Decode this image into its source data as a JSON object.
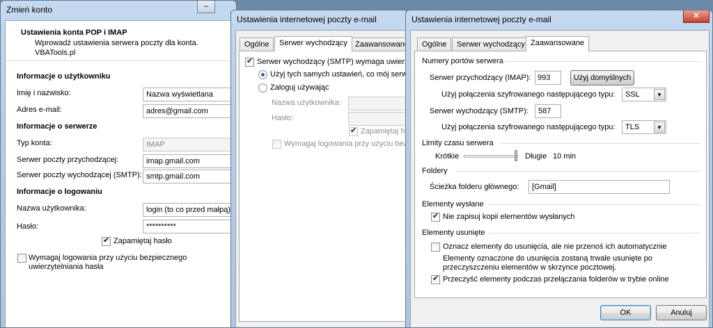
{
  "win1": {
    "title": "Zmień konto",
    "header_title": "Ustawienia konta POP i IMAP",
    "header_sub": "Wprowadź ustawienia serwera poczty dla konta.",
    "header_sub2": "VBATools.pl",
    "user_section": "Informacje o użytkowniku",
    "name_label": "Imię i nazwisko:",
    "name_value": "Nazwa wyświetlana",
    "email_label": "Adres e-mail:",
    "email_value": "adres@gmail.com",
    "server_section": "Informacje o serwerze",
    "type_label": "Typ konta:",
    "type_value": "IMAP",
    "incoming_label": "Serwer poczty przychodzącej:",
    "incoming_value": "imap.gmail.com",
    "outgoing_label": "Serwer poczty wychodzącej (SMTP):",
    "outgoing_value": "smtp.gmail.com",
    "login_section": "Informacje o logowaniu",
    "user_label": "Nazwa użytkownika:",
    "user_value": "login (to co przed małpą)",
    "pass_label": "Hasło:",
    "pass_value": "**********",
    "remember_label": "Zapamiętaj hasło",
    "spa_label1": "Wymagaj logowania przy użyciu bezpiecznego",
    "spa_label2": "uwierzytelniania hasła"
  },
  "win2": {
    "title": "Ustawienia internetowej poczty e-mail",
    "tabs": [
      "Ogólne",
      "Serwer wychodzący",
      "Zaawansowane"
    ],
    "smtp_auth": "Serwer wychodzący (SMTP) wymaga uwierzy",
    "same_settings": "Użyj tych samych ustawień, co mój serwe",
    "login_using": "Zaloguj używając",
    "user_label": "Nazwa użytkownika:",
    "pass_label": "Hasło:",
    "remember": "Zapamiętaj ha",
    "spa": "Wymagaj logowania przy użyciu bez"
  },
  "win3": {
    "title": "Ustawienia internetowej poczty e-mail",
    "tabs": [
      "Ogólne",
      "Serwer wychodzący",
      "Zaawansowane"
    ],
    "ports_section": "Numery portów serwera",
    "in_label": "Serwer przychodzący (IMAP):",
    "in_port": "993",
    "defaults_btn": "Użyj domyślnych",
    "enc1_label": "Użyj połączenia szyfrowanego następującego typu:",
    "enc1_value": "SSL",
    "out_label": "Serwer wychodzący (SMTP):",
    "out_port": "587",
    "enc2_label": "Użyj połączenia szyfrowanego następującego typu:",
    "enc2_value": "TLS",
    "timeout_section": "Limity czasu serwera",
    "short": "Krótkie",
    "long": "Długie",
    "timeout_value": "10 min",
    "folders_section": "Foldery",
    "root_label": "Ścieżka folderu głównego:",
    "root_value": "[Gmail]",
    "sent_section": "Elementy wysłane",
    "no_copies": "Nie zapisuj kopii elementów wysłanych",
    "deleted_section": "Elementy usunięte",
    "mark_deleted": "Oznacz elementy do usunięcia, ale nie przenoś ich automatycznie",
    "mark_note1": "Elementy oznaczone do usunięcia zostaną trwale usunięte po",
    "mark_note2": "przeczyszczeniu elementów w skrzynce pocztowej.",
    "purge": "Przeczyść elementy podczas przełączania folderów w trybie online",
    "ok": "OK",
    "cancel": "Anuluj",
    "close_glyph": "✕"
  }
}
